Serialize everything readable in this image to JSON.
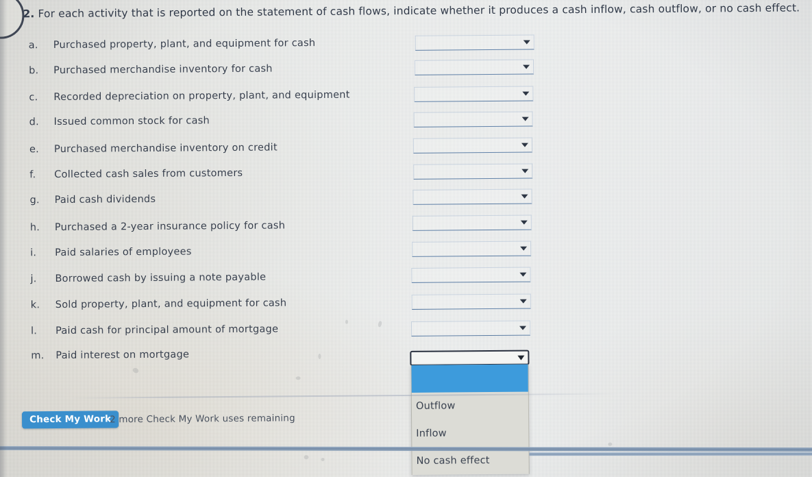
{
  "question": {
    "number": "2.",
    "text": "For each activity that is reported on the statement of cash flows, indicate whether it produces a cash inflow, cash outflow, or no cash effect."
  },
  "nav": {
    "back_icon": "chevron-left-icon"
  },
  "activities": [
    {
      "letter": "a.",
      "label": "Purchased property, plant, and equipment for cash",
      "answer": ""
    },
    {
      "letter": "b.",
      "label": "Purchased merchandise inventory for cash",
      "answer": ""
    },
    {
      "letter": "c.",
      "label": "Recorded depreciation on property, plant, and equipment",
      "answer": ""
    },
    {
      "letter": "d.",
      "label": "Issued common stock for cash",
      "answer": ""
    },
    {
      "letter": "e.",
      "label": "Purchased merchandise inventory on credit",
      "answer": ""
    },
    {
      "letter": "f.",
      "label": "Collected cash sales from customers",
      "answer": ""
    },
    {
      "letter": "g.",
      "label": "Paid cash dividends",
      "answer": ""
    },
    {
      "letter": "h.",
      "label": "Purchased a 2-year insurance policy for cash",
      "answer": ""
    },
    {
      "letter": "i.",
      "label": "Paid salaries of employees",
      "answer": ""
    },
    {
      "letter": "j.",
      "label": "Borrowed cash by issuing a note payable",
      "answer": ""
    },
    {
      "letter": "k.",
      "label": "Sold property, plant, and equipment for cash",
      "answer": ""
    },
    {
      "letter": "l.",
      "label": "Paid cash for principal amount of mortgage",
      "answer": ""
    },
    {
      "letter": "m.",
      "label": "Paid interest on mortgage",
      "answer": ""
    }
  ],
  "dropdown": {
    "open_for_row": "m.",
    "selected_value": "",
    "caret_icon": "chevron-down-icon",
    "options": [
      {
        "label": "",
        "selected": true
      },
      {
        "label": "Outflow",
        "selected": false
      },
      {
        "label": "Inflow",
        "selected": false
      },
      {
        "label": "No cash effect",
        "selected": false
      }
    ]
  },
  "toolbar": {
    "check_button_label": "Check My Work",
    "uses_remaining_text": "2 more Check My Work uses remaining"
  },
  "colors": {
    "accent_blue": "#3a8fcd",
    "selection_blue": "#3d9bdc",
    "text": "#39414f",
    "select_underline": "#5e7fa6",
    "background": "#eeefeb"
  }
}
